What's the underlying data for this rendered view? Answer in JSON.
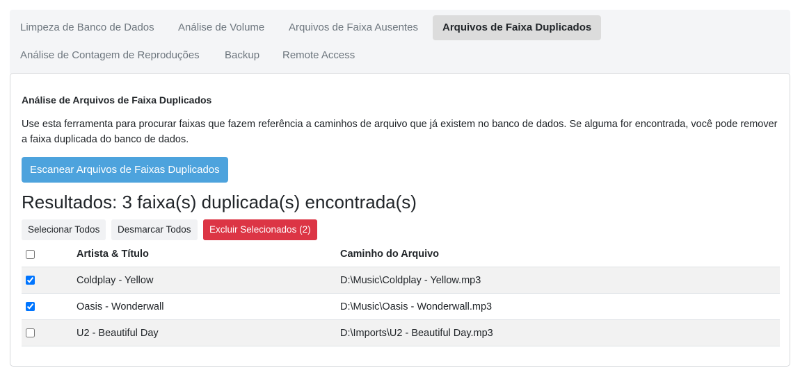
{
  "tabs": [
    {
      "label": "Limpeza de Banco de Dados",
      "active": false
    },
    {
      "label": "Análise de Volume",
      "active": false
    },
    {
      "label": "Arquivos de Faixa Ausentes",
      "active": false
    },
    {
      "label": "Arquivos de Faixa Duplicados",
      "active": true
    },
    {
      "label": "Análise de Contagem de Reproduções",
      "active": false
    },
    {
      "label": "Backup",
      "active": false
    },
    {
      "label": "Remote Access",
      "active": false
    }
  ],
  "panel": {
    "title": "Análise de Arquivos de Faixa Duplicados",
    "description": "Use esta ferramenta para procurar faixas que fazem referência a caminhos de arquivo que já existem no banco de dados. Se alguma for encontrada, você pode remover a faixa duplicada do banco de dados.",
    "scan_button": "Escanear Arquivos de Faixas Duplicados"
  },
  "results": {
    "title": "Resultados: 3 faixa(s) duplicada(s) encontrada(s)",
    "select_all": "Selecionar Todos",
    "deselect_all": "Desmarcar Todos",
    "delete_selected": "Excluir Selecionados (2)",
    "columns": {
      "artist_title": "Artista & Título",
      "path": "Caminho do Arquivo"
    },
    "rows": [
      {
        "title": "Coldplay - Yellow",
        "path": "D:\\Music\\Coldplay - Yellow.mp3",
        "checked": true
      },
      {
        "title": "Oasis - Wonderwall",
        "path": "D:\\Music\\Oasis - Wonderwall.mp3",
        "checked": true
      },
      {
        "title": "U2 - Beautiful Day",
        "path": "D:\\Imports\\U2 - Beautiful Day.mp3",
        "checked": false
      }
    ]
  },
  "colors": {
    "primary": "#4da3dd",
    "danger": "#dc3545",
    "active_tab": "#dcdcdc",
    "tab_bar": "#f4f5f7"
  }
}
